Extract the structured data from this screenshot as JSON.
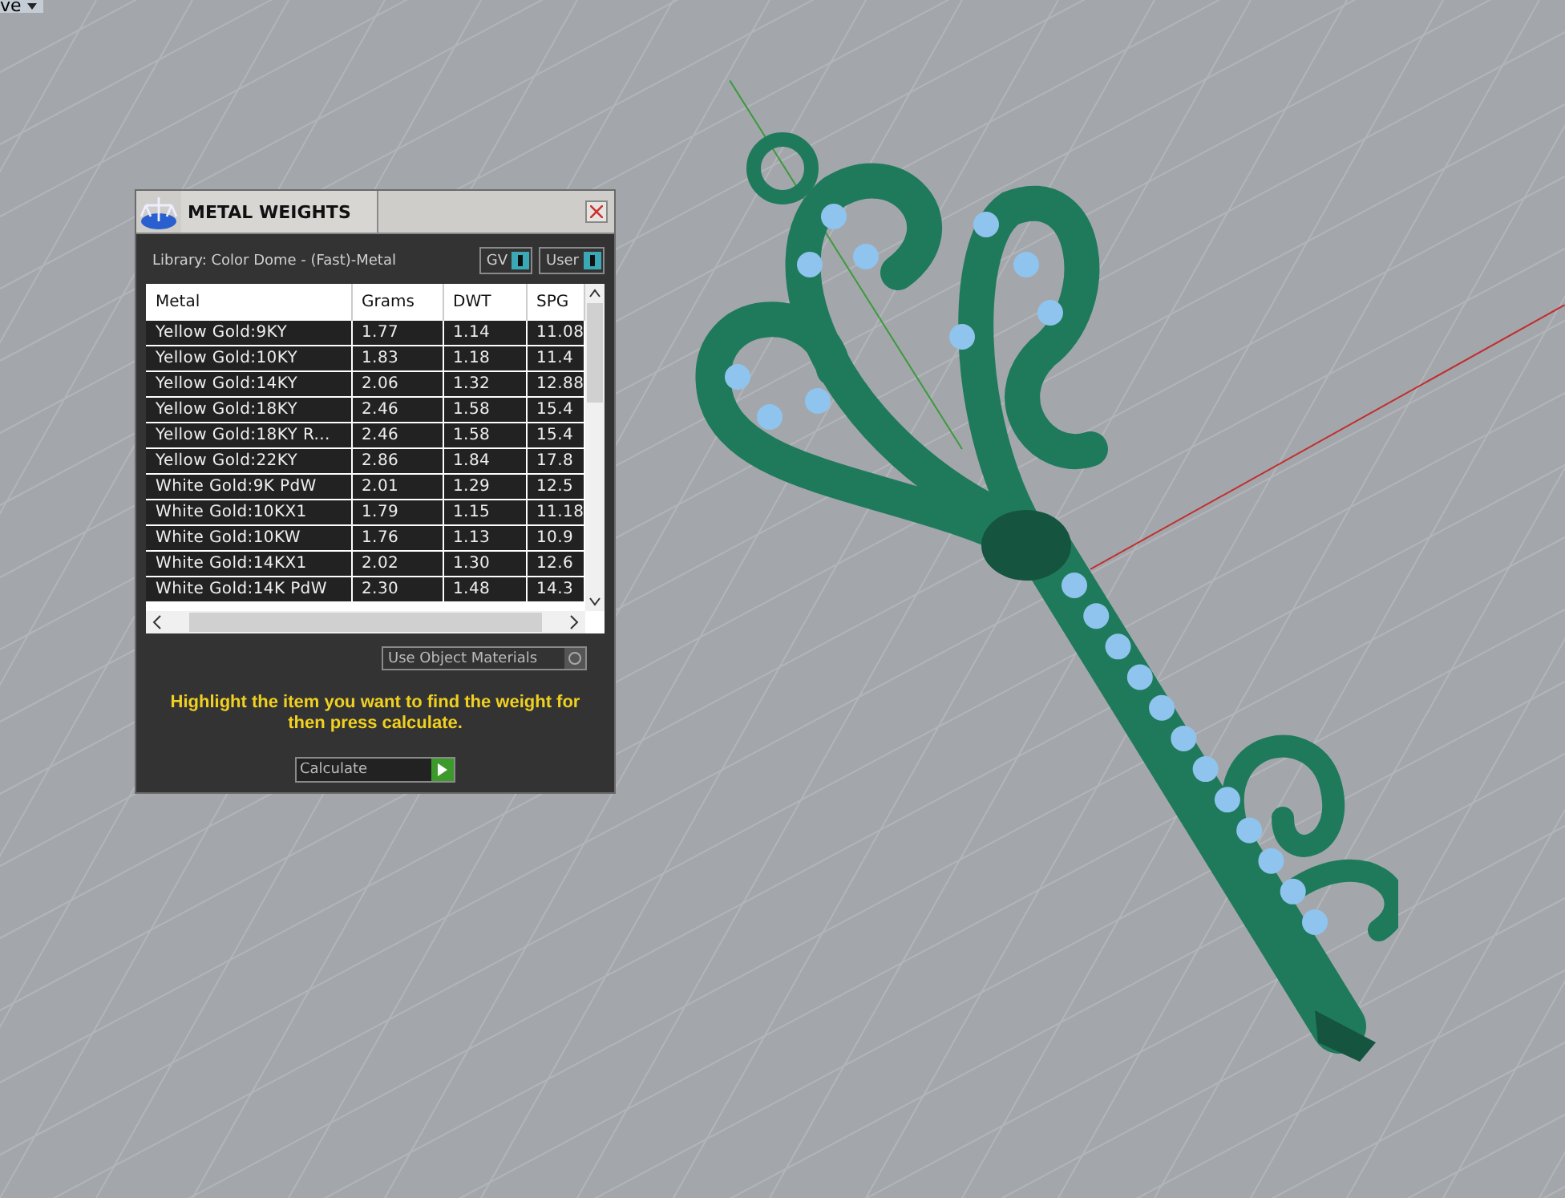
{
  "top_fragment": {
    "text": "ve"
  },
  "panel": {
    "title": "METAL WEIGHTS",
    "library": "Library: Color Dome - (Fast)-Metal",
    "toggles": [
      {
        "label": "GV",
        "on": true
      },
      {
        "label": "User",
        "on": true
      }
    ],
    "table": {
      "columns": [
        "Metal",
        "Grams",
        "DWT",
        "SPG"
      ],
      "rows": [
        [
          "Yellow Gold:9KY",
          "1.77",
          "1.14",
          "11.08"
        ],
        [
          "Yellow Gold:10KY",
          "1.83",
          "1.18",
          "11.4"
        ],
        [
          "Yellow Gold:14KY",
          "2.06",
          "1.32",
          "12.88"
        ],
        [
          "Yellow Gold:18KY",
          "2.46",
          "1.58",
          "15.4"
        ],
        [
          "Yellow Gold:18KY R...",
          "2.46",
          "1.58",
          "15.4"
        ],
        [
          "Yellow Gold:22KY",
          "2.86",
          "1.84",
          "17.8"
        ],
        [
          "White Gold:9K PdW",
          "2.01",
          "1.29",
          "12.5"
        ],
        [
          "White Gold:10KX1",
          "1.79",
          "1.15",
          "11.18"
        ],
        [
          "White Gold:10KW",
          "1.76",
          "1.13",
          "10.9"
        ],
        [
          "White Gold:14KX1",
          "2.02",
          "1.30",
          "12.6"
        ],
        [
          "White Gold:14K PdW",
          "2.30",
          "1.48",
          "14.3"
        ]
      ]
    },
    "use_object_materials": {
      "label": "Use Object Materials",
      "on": false
    },
    "hint": "Highlight the item you want to find the weight for then press calculate.",
    "calculate_button": "Calculate"
  }
}
